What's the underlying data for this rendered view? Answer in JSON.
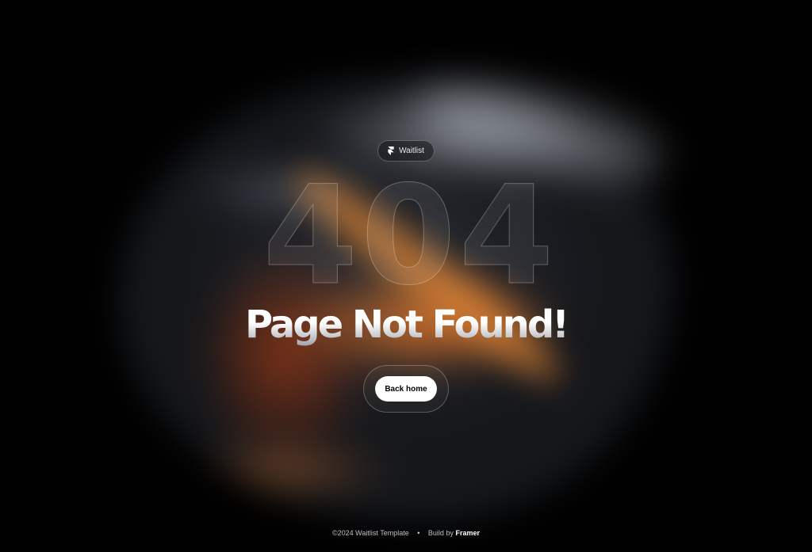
{
  "badge": {
    "label": "Waitlist",
    "icon": "framer-icon"
  },
  "hero": {
    "code": "404",
    "title": "Page Not Found!"
  },
  "cta": {
    "label": "Back home"
  },
  "footer": {
    "copyright": "©2024 Waitlist Template",
    "separator": "•",
    "build_prefix": "Build by",
    "brand": "Framer"
  },
  "colors": {
    "background": "#000000",
    "accent_orange": "#e8782a",
    "button_bg": "#ffffff"
  }
}
